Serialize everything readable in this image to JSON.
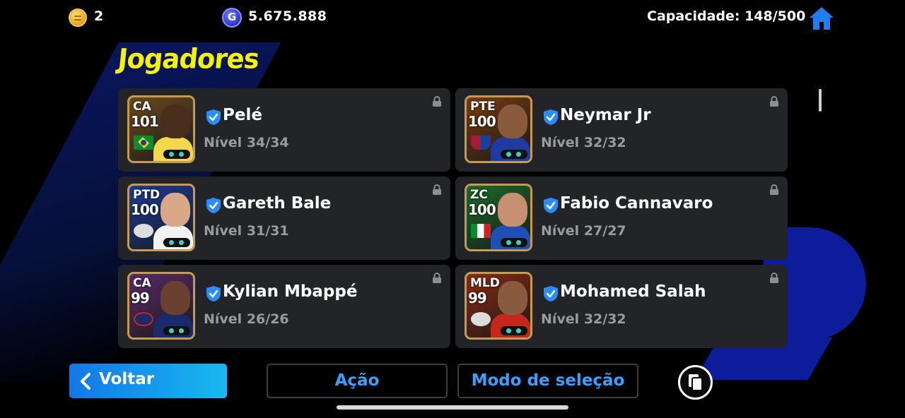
{
  "topbar": {
    "coins": "2",
    "gp": "5.675.888",
    "capacity": "Capacidade: 148/500",
    "home_icon": "home-icon",
    "gp_icon_letter": "G"
  },
  "title": "Jogadores",
  "players": [
    {
      "position": "CA",
      "rating": "101",
      "name": "Pelé",
      "level": "Nível 34/34",
      "badge": "brazil-flag",
      "colors": {
        "bg": "#6b4a1e",
        "face": "#4a2e1c",
        "body": "#f2d84a"
      }
    },
    {
      "position": "PTE",
      "rating": "100",
      "name": "Neymar Jr",
      "level": "Nível 32/32",
      "badge": "barcelona-crest",
      "colors": {
        "bg": "#7a3b0e",
        "face": "#8a5a3c",
        "body": "#1f3aa0"
      }
    },
    {
      "position": "PTD",
      "rating": "100",
      "name": "Gareth Bale",
      "level": "Nível 31/31",
      "badge": "club-crest",
      "colors": {
        "bg": "#1b3c9a",
        "face": "#d8a888",
        "body": "#f2f2f2"
      }
    },
    {
      "position": "ZC",
      "rating": "100",
      "name": "Fabio Cannavaro",
      "level": "Nível 27/27",
      "badge": "italy-flag",
      "colors": {
        "bg": "#1a6b2a",
        "face": "#c89070",
        "body": "#1d4fb5"
      }
    },
    {
      "position": "CA",
      "rating": "99",
      "name": "Kylian Mbappé",
      "level": "Nível 26/26",
      "badge": "psg-crest",
      "colors": {
        "bg": "#5a2a6a",
        "face": "#6a4030",
        "body": "#1a2a6a"
      }
    },
    {
      "position": "MLD",
      "rating": "99",
      "name": "Mohamed Salah",
      "level": "Nível 32/32",
      "badge": "club-crest",
      "colors": {
        "bg": "#8a2a10",
        "face": "#8a5a40",
        "body": "#c4281c"
      }
    }
  ],
  "bottom": {
    "back_label": "Voltar",
    "action_label": "Ação",
    "select_mode_label": "Modo de seleção",
    "copy_icon": "copy-icon"
  },
  "colors": {
    "title": "#f4f20b",
    "card_bg": "#232427",
    "accent_blue": "#3aa0ff",
    "verified_blue": "#2b8cff"
  }
}
